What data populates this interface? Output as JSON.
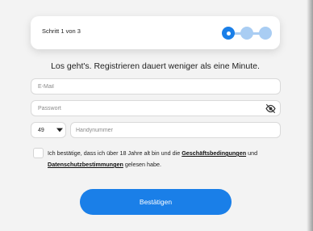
{
  "progress": {
    "label": "Schritt 1 von 3",
    "current_step": 1,
    "total_steps": 3
  },
  "headline": "Los geht's. Registrieren dauert weniger als eine Minute.",
  "form": {
    "email_placeholder": "E-Mail",
    "password_placeholder": "Passwort",
    "country_code": "49",
    "phone_placeholder": "Handynummer"
  },
  "consent": {
    "text_before": "Ich bestätige, dass ich über 18 Jahre alt bin und die ",
    "terms_link": "Geschäftsbedingungen",
    "text_middle": " und ",
    "privacy_link": "Datenschutzbestimmungen",
    "text_after": " gelesen habe."
  },
  "submit_label": "Bestätigen",
  "colors": {
    "accent": "#1a7fe8",
    "accent_light": "#a9cdf3",
    "background": "#f3f3f3"
  },
  "icons": {
    "password_toggle": "eye-slash-icon",
    "select_arrow": "chevron-down-icon"
  }
}
